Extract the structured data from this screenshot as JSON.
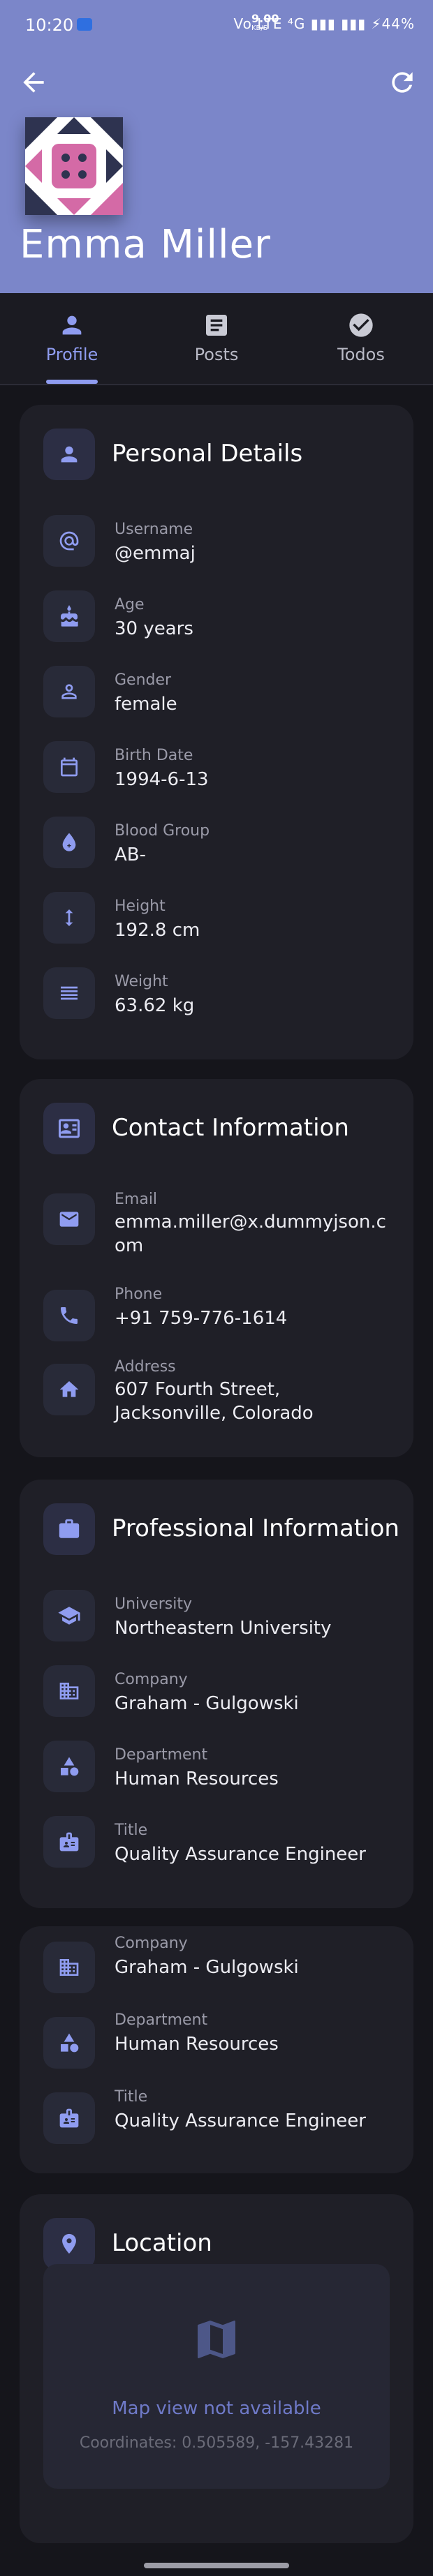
{
  "status_bar": {
    "time": "10:20",
    "speed": "9.00",
    "speed_unit": "KB/S",
    "right": "Vo LTE  ⁴G  ▮▮▮  ▮▮▮  ⚡44%"
  },
  "header": {
    "name": "Emma Miller"
  },
  "tabs": [
    {
      "label": "Profile",
      "icon": "person-icon",
      "active": true
    },
    {
      "label": "Posts",
      "icon": "article-icon",
      "active": false
    },
    {
      "label": "Todos",
      "icon": "check-circle-icon",
      "active": false
    }
  ],
  "personal": {
    "title": "Personal Details",
    "rows": [
      {
        "label": "Username",
        "value": "@emmaj",
        "icon": "at-icon"
      },
      {
        "label": "Age",
        "value": "30 years",
        "icon": "cake-icon"
      },
      {
        "label": "Gender",
        "value": "female",
        "icon": "person-outline-icon"
      },
      {
        "label": "Birth Date",
        "value": "1994-6-13",
        "icon": "calendar-icon"
      },
      {
        "label": "Blood Group",
        "value": "AB-",
        "icon": "blood-drop-icon"
      },
      {
        "label": "Height",
        "value": "192.8 cm",
        "icon": "height-icon"
      },
      {
        "label": "Weight",
        "value": "63.62 kg",
        "icon": "weight-icon"
      }
    ]
  },
  "contact": {
    "title": "Contact Information",
    "rows": [
      {
        "label": "Email",
        "value": "emma.miller@x.dummyjson.com",
        "icon": "mail-icon"
      },
      {
        "label": "Phone",
        "value": "+91 759-776-1614",
        "icon": "phone-icon"
      },
      {
        "label": "Address",
        "value": "607 Fourth Street, Jacksonville, Colorado",
        "icon": "home-icon"
      }
    ]
  },
  "professional": {
    "title": "Professional Information",
    "rows": [
      {
        "label": "University",
        "value": "Northeastern University",
        "icon": "school-icon"
      },
      {
        "label": "Company",
        "value": "Graham - Gulgowski",
        "icon": "company-icon"
      },
      {
        "label": "Department",
        "value": "Human Resources",
        "icon": "department-icon"
      },
      {
        "label": "Title",
        "value": "Quality Assurance Engineer",
        "icon": "badge-icon"
      }
    ]
  },
  "professional_repeat": {
    "rows": [
      {
        "label": "Company",
        "value": "Graham - Gulgowski",
        "icon": "company-icon"
      },
      {
        "label": "Department",
        "value": "Human Resources",
        "icon": "department-icon"
      },
      {
        "label": "Title",
        "value": "Quality Assurance Engineer",
        "icon": "badge-icon"
      }
    ]
  },
  "location": {
    "title": "Location",
    "map_message": "Map view not available",
    "coordinates": "Coordinates: 0.505589, -157.43281"
  },
  "colors": {
    "header_bg": "#7b86c9",
    "accent": "#8f9cf0",
    "card_bg": "#1f1f27",
    "page_bg": "#15151b"
  }
}
